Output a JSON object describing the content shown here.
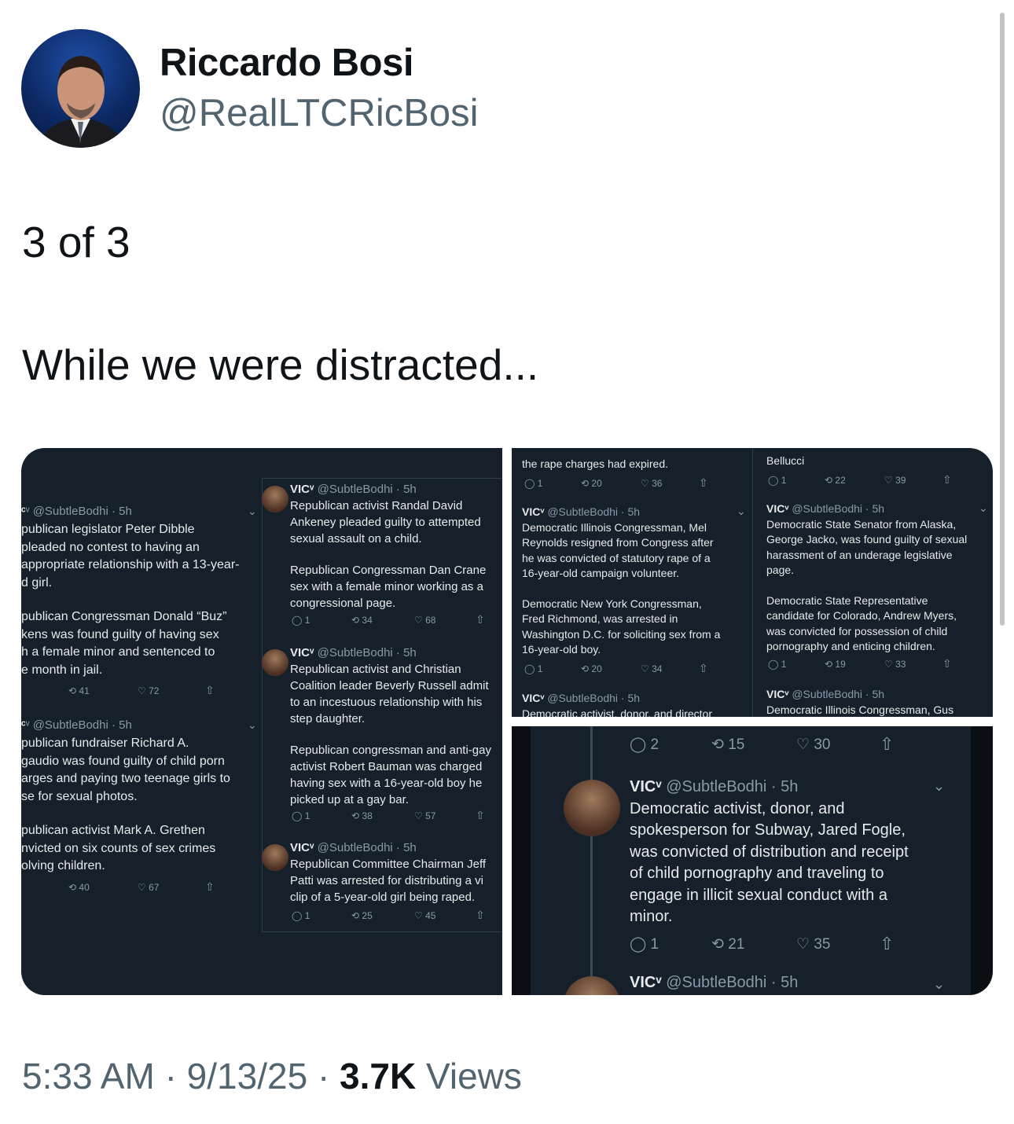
{
  "author": {
    "name": "Riccardo Bosi",
    "handle": "@RealLTCRicBosi"
  },
  "tweet": {
    "line1": "3 of 3",
    "line2": "While we were distracted..."
  },
  "meta": {
    "time": "5:33 AM",
    "sep1": "·",
    "date": "9/13/25",
    "sep2": "·",
    "views_count": "3.7K",
    "views_label": "Views"
  },
  "images": {
    "left_col": [
      {
        "head": "VIC",
        "sub": "@SubtleBodhi · 5h",
        "body1": "publican legislator Peter Dibble\npleaded no contest to having an\nappropriate relationship with a 13-year-\nd girl.",
        "body2": "publican Congressman Donald “Buz”\nkens was found guilty of having sex\nh a female minor and sentenced to\ne month in jail.",
        "rt": "41",
        "likes": "72"
      },
      {
        "head": "VIC",
        "sub": "@SubtleBodhi · 5h",
        "body1": "publican fundraiser Richard A.\ngaudio was found guilty of child porn\narges and paying two teenage girls to\nse for sexual photos.",
        "body2": "publican activist Mark A. Grethen\nnvicted on six counts of sex crimes\nolving children.",
        "rt": "40",
        "likes": "67"
      }
    ],
    "right_col": [
      {
        "head": "VIC",
        "sub": "@SubtleBodhi · 5h",
        "body1": "Republican activist Randal David\nAnkeney pleaded guilty to attempted\nsexual assault on a child.",
        "body2": "Republican Congressman Dan Crane\nsex with a female minor working as a\ncongressional page.",
        "reply": "1",
        "rt": "34",
        "likes": "68"
      },
      {
        "head": "VIC",
        "sub": "@SubtleBodhi · 5h",
        "body1": "Republican activist and Christian\nCoalition leader Beverly Russell admit\nto an incestuous relationship with his\nstep daughter.",
        "body2": "Republican congressman and anti-gay\nactivist Robert Bauman was charged\nhaving sex with a 16-year-old boy he\npicked up at a gay bar.",
        "reply": "1",
        "rt": "38",
        "likes": "57"
      },
      {
        "head": "VIC",
        "sub": "@SubtleBodhi · 5h",
        "body1": "Republican Committee Chairman Jeff\nPatti was arrested for distributing a vi\nclip of a 5-year-old girl being raped.",
        "body2": "",
        "reply": "1",
        "rt": "25",
        "likes": "45"
      }
    ],
    "top_mid": [
      {
        "body_top": "the rape charges had expired.",
        "reply": "1",
        "rt": "20",
        "likes": "36"
      },
      {
        "head": "VIC",
        "sub": "@SubtleBodhi · 5h",
        "body1": "Democratic Illinois Congressman, Mel\nReynolds resigned from Congress after\nhe was convicted of statutory rape of a\n16-year-old campaign volunteer.",
        "body2": "Democratic New York Congressman,\nFred Richmond, was arrested in\nWashington D.C. for soliciting sex from a\n16-year-old boy.",
        "reply": "1",
        "rt": "20",
        "likes": "34"
      },
      {
        "head": "VIC",
        "sub": "@SubtleBodhi · 5h",
        "body_cut": "Democratic activist, donor, and director"
      }
    ],
    "top_right": [
      {
        "body_top": "Bellucci",
        "reply": "1",
        "rt": "22",
        "likes": "39"
      },
      {
        "head": "VIC",
        "sub": "@SubtleBodhi · 5h",
        "body1": "Democratic State Senator from Alaska,\nGeorge Jacko, was found guilty of sexual\nharassment of an underage legislative\npage.",
        "body2": "Democratic State Representative\ncandidate for Colorado, Andrew Myers,\nwas convicted for possession of child\npornography and enticing children.",
        "reply": "1",
        "rt": "19",
        "likes": "33"
      },
      {
        "head": "VIC",
        "sub": "@SubtleBodhi · 5h",
        "body_cut": "Democratic Illinois Congressman, Gus"
      }
    ],
    "bottom_zoom": {
      "top_reply": "2",
      "top_rt": "15",
      "top_likes": "30",
      "head": "VIC",
      "sub": "@SubtleBodhi · 5h",
      "body": "Democratic activist, donor, and\nspokesperson for Subway, Jared Fogle,\nwas convicted of distribution and receipt\nof child pornography and traveling to\nengage in illicit sexual conduct with a\nminor.",
      "reply": "1",
      "rt": "21",
      "likes": "35",
      "next_head": "VIC",
      "next_sub": "@SubtleBodhi · 5h"
    }
  },
  "icons": {
    "reply": "reply-icon",
    "retweet": "retweet-icon",
    "like": "like-icon",
    "share": "share-icon",
    "chevron": "chevron-down-icon"
  },
  "colors": {
    "panel_bg": "#15202b",
    "text_light": "#e7e9ea",
    "text_muted": "#8b98a5",
    "handle_grey": "#536471"
  }
}
